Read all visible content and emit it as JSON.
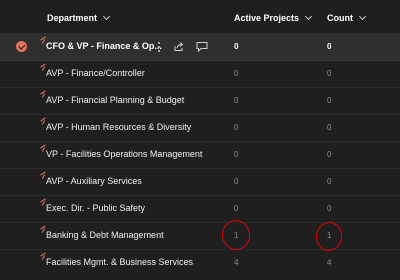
{
  "columns": {
    "department": "Department",
    "active_projects": "Active Projects",
    "count": "Count"
  },
  "rows": [
    {
      "name": "CFO & VP - Finance & Op...",
      "active": "0",
      "count": "0",
      "selected": true
    },
    {
      "name": "AVP - Finance/Controller",
      "active": "0",
      "count": "0"
    },
    {
      "name": "AVP - Financial Planning & Budget",
      "active": "0",
      "count": "0"
    },
    {
      "name": "AVP - Human Resources & Diversity",
      "active": "0",
      "count": "0"
    },
    {
      "name": "VP - Facilities Operations Management",
      "active": "0",
      "count": "0"
    },
    {
      "name": "AVP - Auxiliary Services",
      "active": "0",
      "count": "0"
    },
    {
      "name": "Exec. Dir. - Public Safety",
      "active": "0",
      "count": "0"
    },
    {
      "name": "Banking & Debt Management",
      "active": "1",
      "count": "1"
    },
    {
      "name": "Facilities Mgmt. & Business Services",
      "active": "4",
      "count": "4"
    }
  ],
  "icons": {
    "select": "check-circle-icon",
    "more": "more-vertical-icon",
    "share": "share-icon",
    "comment": "comment-icon",
    "new_item": "new-item-icon",
    "sort": "chevron-down-icon"
  },
  "colors": {
    "background": "#1f1f1f",
    "selected_row": "#2f2f2f",
    "accent": "#e3735e",
    "annotation": "#e00000"
  }
}
